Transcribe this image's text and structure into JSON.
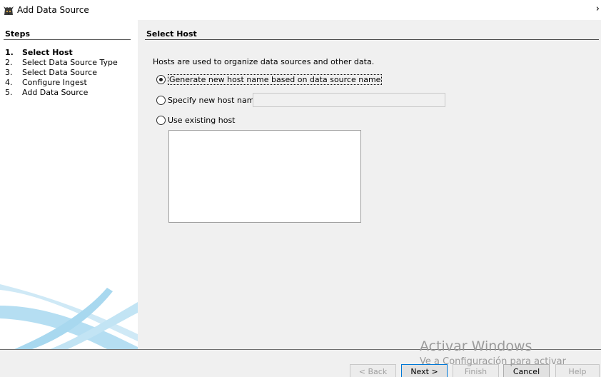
{
  "window": {
    "title": "Add Data Source",
    "icon": "dog-icon",
    "chevron": "›"
  },
  "steps": {
    "heading": "Steps",
    "items": [
      {
        "num": "1.",
        "label": "Select Host"
      },
      {
        "num": "2.",
        "label": "Select Data Source Type"
      },
      {
        "num": "3.",
        "label": "Select Data Source"
      },
      {
        "num": "4.",
        "label": "Configure Ingest"
      },
      {
        "num": "5.",
        "label": "Add Data Source"
      }
    ]
  },
  "panel": {
    "title": "Select Host",
    "intro": "Hosts are used to organize data sources and other data.",
    "options": {
      "generate": "Generate new host name based on data source name",
      "specify": "Specify new host name",
      "existing": "Use existing host"
    },
    "selected_option": "generate",
    "host_name_value": ""
  },
  "buttons": {
    "back": "< Back",
    "next": "Next >",
    "finish": "Finish",
    "cancel": "Cancel",
    "help": "Help"
  },
  "watermark": {
    "line1": "Activar Windows",
    "line2": "Ve a Configuración para activar"
  },
  "colors": {
    "panel_bg": "#f0f0f0",
    "swoosh": "#9fd4ee",
    "default_button_border": "#0078d7"
  }
}
